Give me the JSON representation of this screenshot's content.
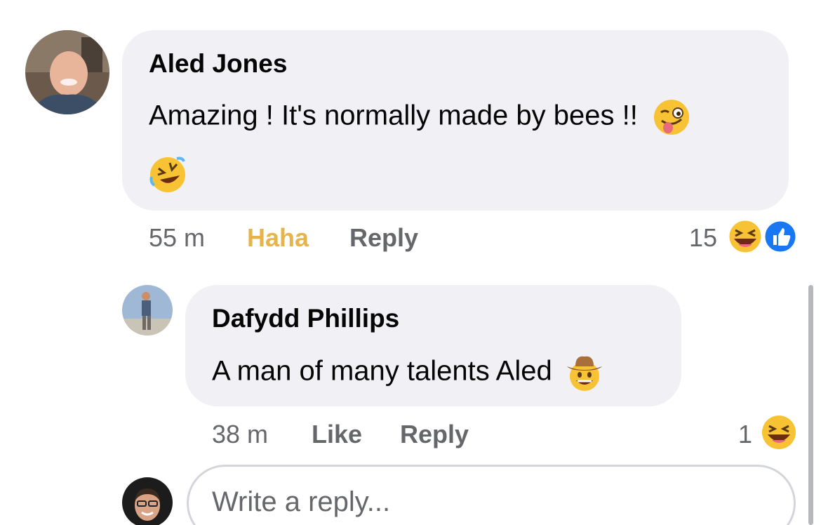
{
  "comment1": {
    "author": "Aled Jones",
    "text_line1": "Amazing ! It's normally made by bees !!",
    "text_emojis": [
      "winking-tongue-emoji",
      "rolling-on-floor-laughing-emoji"
    ],
    "time": "55 m",
    "reaction_action": "Haha",
    "reply_label": "Reply",
    "reaction_count": "15",
    "reaction_icons": [
      "haha-reaction-icon",
      "like-reaction-icon"
    ]
  },
  "comment2": {
    "author": "Dafydd Phillips",
    "text": "A man of many talents Aled",
    "text_emojis": [
      "cowboy-emoji"
    ],
    "time": "38 m",
    "like_label": "Like",
    "reply_label": "Reply",
    "reaction_count": "1",
    "reaction_icons": [
      "haha-reaction-icon"
    ]
  },
  "reply_input": {
    "placeholder": "Write a reply..."
  },
  "colors": {
    "bubble": "#f0f0f5",
    "meta_text": "#65676b",
    "haha_active": "#e5b44a",
    "like_blue": "#1877f2"
  }
}
